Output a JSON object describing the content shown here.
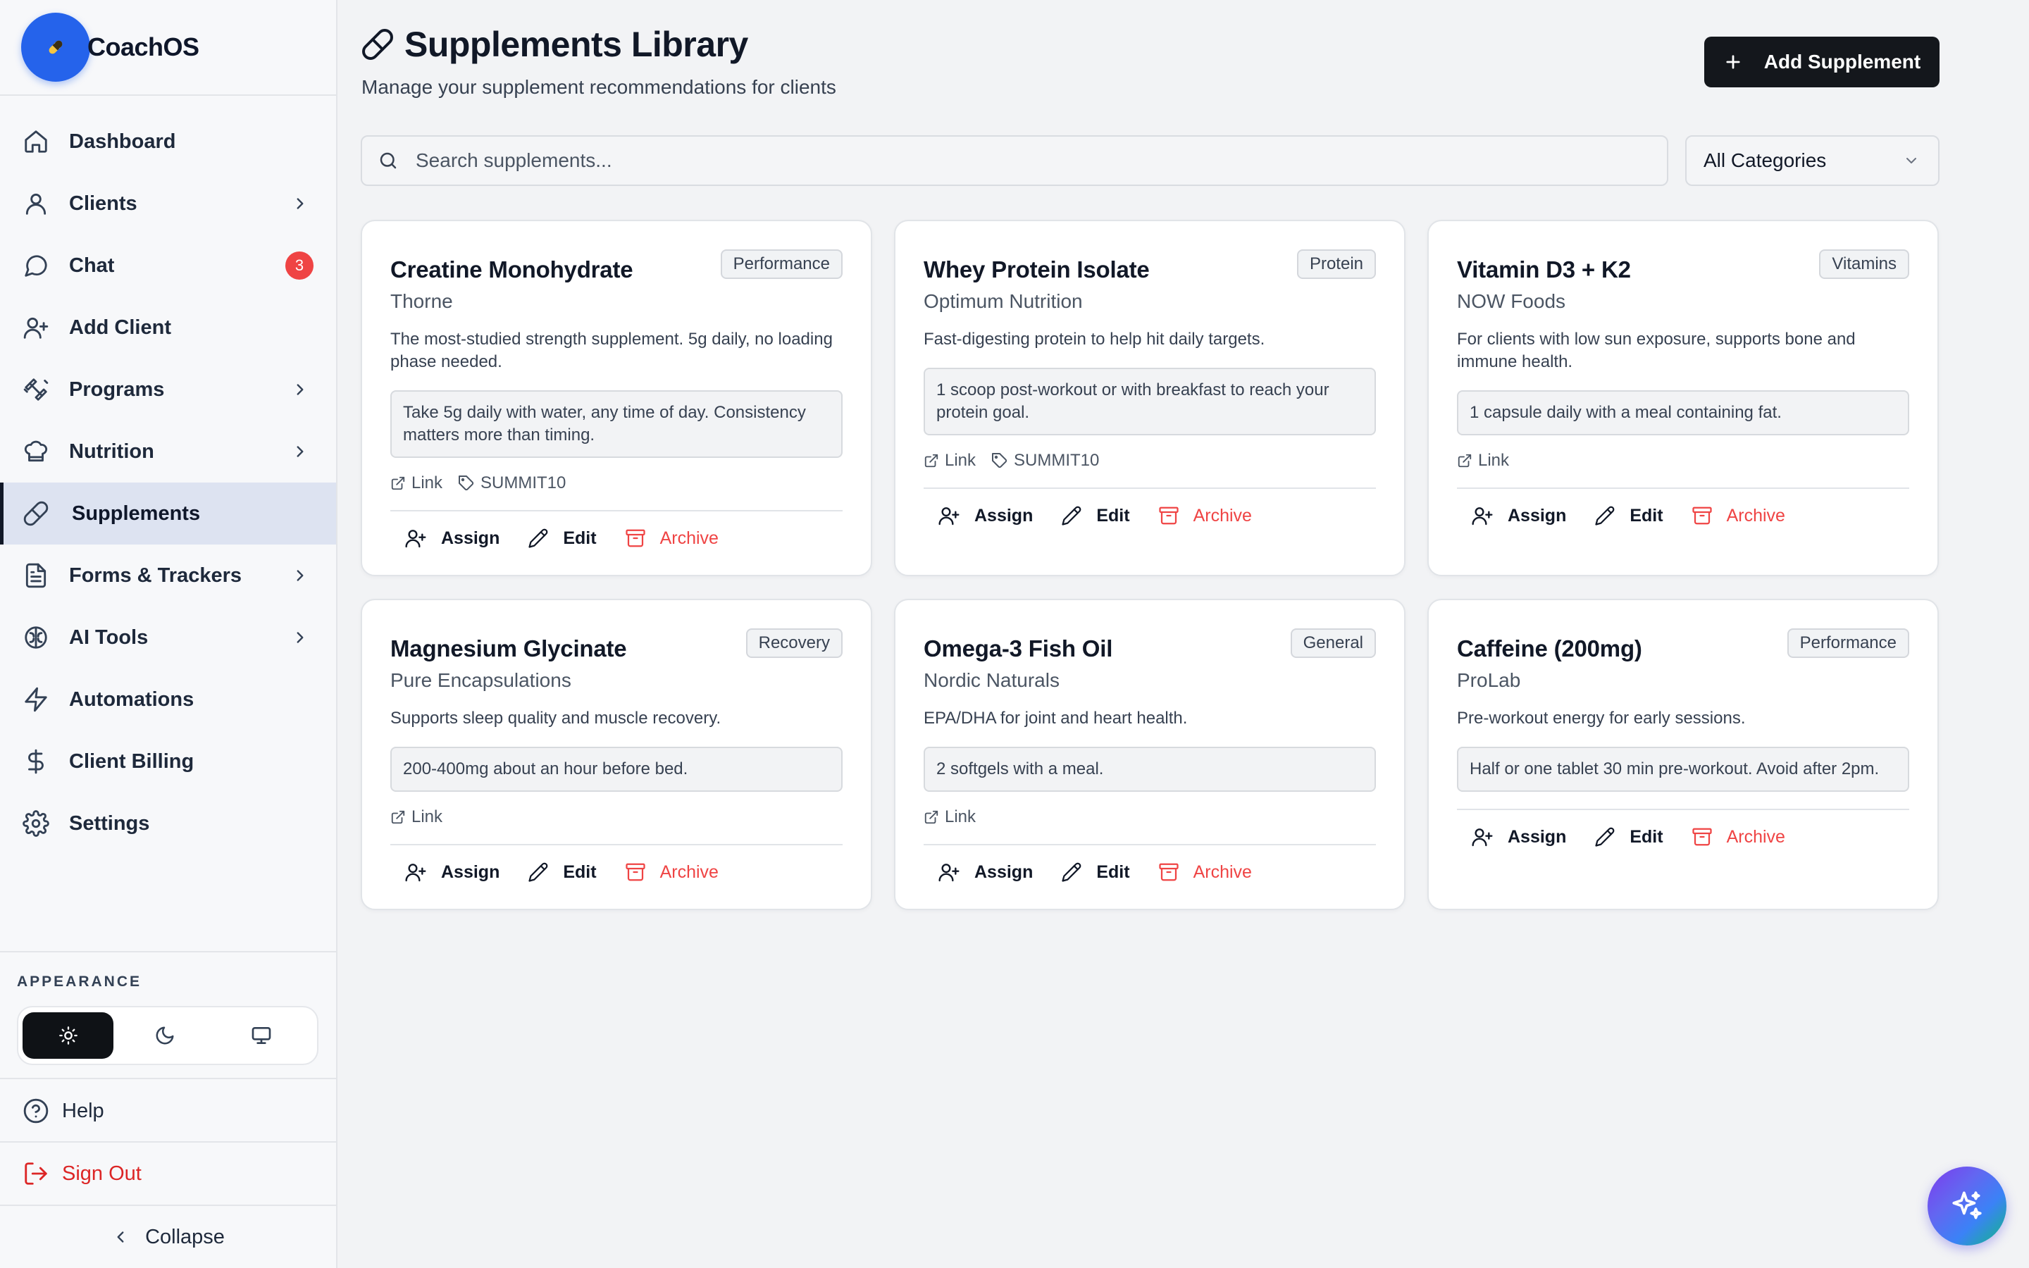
{
  "brand": {
    "name": "CoachOS",
    "logo_color": "#2563eb"
  },
  "sidebar": {
    "items": [
      {
        "label": "Dashboard",
        "icon": "home-icon"
      },
      {
        "label": "Clients",
        "icon": "user-icon",
        "has_submenu": true
      },
      {
        "label": "Chat",
        "icon": "chat-icon",
        "badge": "3"
      },
      {
        "label": "Add Client",
        "icon": "user-plus-icon"
      },
      {
        "label": "Programs",
        "icon": "dumbbell-icon",
        "has_submenu": true
      },
      {
        "label": "Nutrition",
        "icon": "chef-hat-icon",
        "has_submenu": true
      },
      {
        "label": "Supplements",
        "icon": "pill-icon",
        "active": true
      },
      {
        "label": "Forms & Trackers",
        "icon": "document-icon",
        "has_submenu": true
      },
      {
        "label": "AI Tools",
        "icon": "brain-icon",
        "has_submenu": true
      },
      {
        "label": "Automations",
        "icon": "lightning-icon"
      },
      {
        "label": "Client Billing",
        "icon": "dollar-icon"
      },
      {
        "label": "Settings",
        "icon": "gear-icon"
      }
    ],
    "appearance_title": "APPEARANCE",
    "theme_options": [
      "sun-icon",
      "moon-icon",
      "monitor-icon"
    ],
    "theme_selected": "light",
    "help_label": "Help",
    "signout_label": "Sign Out",
    "collapse_label": "Collapse"
  },
  "header": {
    "title": "Supplements Library",
    "subtitle": "Manage your supplement recommendations for clients",
    "add_button_label": "Add Supplement"
  },
  "filters": {
    "search_placeholder": "Search supplements...",
    "search_value": "",
    "category_selected": "All Categories"
  },
  "actions": {
    "assign": "Assign",
    "edit": "Edit",
    "archive": "Archive",
    "link": "Link"
  },
  "supplements": [
    {
      "name": "Creatine Monohydrate",
      "brand": "Thorne",
      "category": "Performance",
      "description": "The most-studied strength supplement. 5g daily, no loading phase needed.",
      "instructions": "Take 5g daily with water, any time of day. Consistency matters more than timing.",
      "has_link": true,
      "code": "SUMMIT10"
    },
    {
      "name": "Whey Protein Isolate",
      "brand": "Optimum Nutrition",
      "category": "Protein",
      "description": "Fast-digesting protein to help hit daily targets.",
      "instructions": "1 scoop post-workout or with breakfast to reach your protein goal.",
      "has_link": true,
      "code": "SUMMIT10"
    },
    {
      "name": "Vitamin D3 + K2",
      "brand": "NOW Foods",
      "category": "Vitamins",
      "description": "For clients with low sun exposure, supports bone and immune health.",
      "instructions": "1 capsule daily with a meal containing fat.",
      "has_link": true,
      "code": ""
    },
    {
      "name": "Magnesium Glycinate",
      "brand": "Pure Encapsulations",
      "category": "Recovery",
      "description": "Supports sleep quality and muscle recovery.",
      "instructions": "200-400mg about an hour before bed.",
      "has_link": true,
      "code": ""
    },
    {
      "name": "Omega-3 Fish Oil",
      "brand": "Nordic Naturals",
      "category": "General",
      "description": "EPA/DHA for joint and heart health.",
      "instructions": "2 softgels with a meal.",
      "has_link": true,
      "code": ""
    },
    {
      "name": "Caffeine (200mg)",
      "brand": "ProLab",
      "category": "Performance",
      "description": "Pre-workout energy for early sessions.",
      "instructions": "Half or one tablet 30 min pre-workout. Avoid after 2pm.",
      "has_link": false,
      "code": ""
    }
  ],
  "colors": {
    "accent_dark": "#14171c",
    "archive_red": "#ef4444",
    "badge_red": "#ef4444",
    "active_nav_bg": "#dde3f1"
  }
}
